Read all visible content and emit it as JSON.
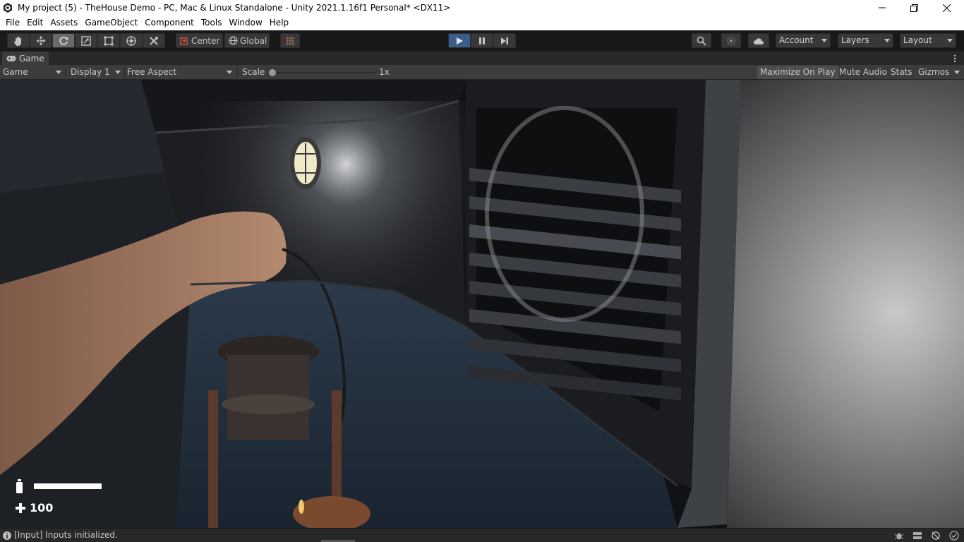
{
  "window": {
    "title": "My project (5) - TheHouse Demo - PC, Mac & Linux Standalone - Unity 2021.1.16f1 Personal* <DX11>"
  },
  "menu": [
    "File",
    "Edit",
    "Assets",
    "GameObject",
    "Component",
    "Tools",
    "Window",
    "Help"
  ],
  "toolbar": {
    "tools": [
      "hand-tool",
      "move-tool",
      "rotate-tool",
      "scale-tool",
      "rect-tool",
      "transform-tool",
      "custom-tool"
    ],
    "active_tool": "rotate-tool",
    "pivot_label": "Center",
    "space_label": "Global",
    "account_label": "Account",
    "layers_label": "Layers",
    "layout_label": "Layout"
  },
  "game_tab": {
    "label": "Game",
    "view_select": "Game",
    "display_select": "Display 1",
    "aspect_select": "Free Aspect",
    "scale_label": "Scale",
    "scale_value": "1x",
    "maximize_label": "Maximize On Play",
    "mute_label": "Mute Audio",
    "stats_label": "Stats",
    "gizmos_label": "Gizmos"
  },
  "hud": {
    "lantern_fuel": 1.0,
    "health": "100"
  },
  "status": {
    "message": "[Input] Inputs initialized."
  },
  "colors": {
    "play_active": "#3a5e8c",
    "editor_bg": "#191919",
    "panel_bg": "#3c3c3c"
  }
}
